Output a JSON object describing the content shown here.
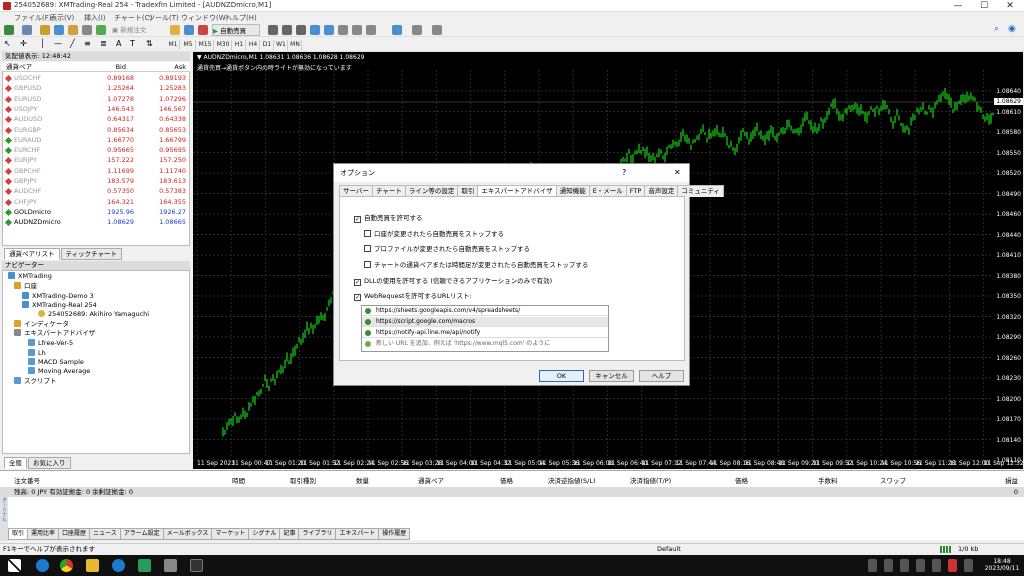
{
  "window": {
    "title": "254052689: XMTrading-Real 254 - Tradexfin Limited - [AUDNZDmicro,M1]",
    "min": "—",
    "max": "☐",
    "close": "✕"
  },
  "menu": [
    "ファイル(F)",
    "表示(V)",
    "挿入(I)",
    "チャート(C)",
    "ツール(T)",
    "ウィンドウ(W)",
    "ヘルプ(H)"
  ],
  "toolbar": {
    "new_order": "新規注文",
    "autotrade": "自動売買"
  },
  "timeframes": [
    "M1",
    "M5",
    "M15",
    "M30",
    "H1",
    "H4",
    "D1",
    "W1",
    "MN"
  ],
  "market_watch": {
    "title": "気配値表示: 12:48:42",
    "col_symbol": "通貨ペア",
    "col_bid": "Bid",
    "col_ask": "Ask",
    "rows": [
      {
        "symbol": "USDCHF",
        "bid": "0.89168",
        "ask": "0.89193",
        "color": "#d43f3f",
        "active": false
      },
      {
        "symbol": "GBPUSD",
        "bid": "1.25264",
        "ask": "1.25283",
        "color": "#d43f3f",
        "active": false
      },
      {
        "symbol": "EURUSD",
        "bid": "1.07278",
        "ask": "1.07296",
        "color": "#d43f3f",
        "active": false
      },
      {
        "symbol": "USDJPY",
        "bid": "146.543",
        "ask": "146.567",
        "color": "#d43f3f",
        "active": false
      },
      {
        "symbol": "AUDUSD",
        "bid": "0.64317",
        "ask": "0.64338",
        "color": "#d43f3f",
        "active": false
      },
      {
        "symbol": "EURGBP",
        "bid": "0.85634",
        "ask": "0.85653",
        "color": "#d43f3f",
        "active": false
      },
      {
        "symbol": "EURAUD",
        "bid": "1.66770",
        "ask": "1.66799",
        "color": "#2a9a2a",
        "active": false
      },
      {
        "symbol": "EURCHF",
        "bid": "0.95665",
        "ask": "0.95695",
        "color": "#2a9a2a",
        "active": false
      },
      {
        "symbol": "EURJPY",
        "bid": "157.222",
        "ask": "157.250",
        "color": "#d43f3f",
        "active": false
      },
      {
        "symbol": "GBPCHF",
        "bid": "1.11699",
        "ask": "1.11740",
        "color": "#d43f3f",
        "active": false
      },
      {
        "symbol": "GBPJPY",
        "bid": "183.579",
        "ask": "183.613",
        "color": "#d43f3f",
        "active": false
      },
      {
        "symbol": "AUDCHF",
        "bid": "0.57350",
        "ask": "0.57383",
        "color": "#d43f3f",
        "active": false
      },
      {
        "symbol": "CHFJPY",
        "bid": "164.321",
        "ask": "164.355",
        "color": "#d43f3f",
        "active": false
      },
      {
        "symbol": "GOLDmicro",
        "bid": "1925.96",
        "ask": "1926.27",
        "color": "#2a9a2a",
        "active": true
      },
      {
        "symbol": "AUDNZDmicro",
        "bid": "1.08629",
        "ask": "1.08665",
        "color": "#2a9a2a",
        "active": true
      }
    ],
    "tabs": [
      "通貨ペアリスト",
      "ティックチャート"
    ]
  },
  "navigator": {
    "title": "ナビゲーター",
    "items": [
      "XMTrading",
      "口座",
      "XMTrading-Demo 3",
      "XMTrading-Real 254",
      "254052689: Akihiro Yamaguchi",
      "インディケータ",
      "エキスパートアドバイザ",
      "Lfree-Ver-5",
      "Lh",
      "MACD Sample",
      "Moving Average",
      "スクリプト"
    ],
    "tabs": [
      "全般",
      "お気に入り"
    ]
  },
  "chart": {
    "info": "▼ AUDNZDmicro,M1  1.08631 1.08636 1.08628 1.08629",
    "info2": "通貨売買→通貨ボタン内の時ライトが無効になっています",
    "price_tag": "1.08629",
    "y_labels": [
      "1.08640",
      "1.08610",
      "1.08580",
      "1.08550",
      "1.08520",
      "1.08490",
      "1.08460",
      "1.08440",
      "1.08410",
      "1.08380",
      "1.08350",
      "1.08320",
      "1.08290",
      "1.08260",
      "1.08230",
      "1.08200",
      "1.08170",
      "1.08140",
      "1.08110"
    ],
    "x_labels": [
      "11 Sep 2023",
      "11 Sep 00:47",
      "11 Sep 01:20",
      "11 Sep 01:52",
      "11 Sep 02:24",
      "11 Sep 02:56",
      "11 Sep 03:28",
      "11 Sep 04:00",
      "11 Sep 04:32",
      "11 Sep 05:04",
      "11 Sep 05:36",
      "11 Sep 06:08",
      "11 Sep 06:40",
      "11 Sep 07:12",
      "11 Sep 07:44",
      "11 Sep 08:16",
      "11 Sep 08:48",
      "11 Sep 09:20",
      "11 Sep 09:52",
      "11 Sep 10:24",
      "11 Sep 10:56",
      "11 Sep 11:28",
      "11 Sep 12:00",
      "11 Sep 12:32"
    ]
  },
  "dialog": {
    "title": "オプション",
    "help": "?",
    "close": "✕",
    "tabs": [
      "サーバー",
      "チャート",
      "ライン等の設定",
      "取引",
      "エキスパートアドバイザ",
      "通知機能",
      "E・メール",
      "FTP",
      "音声設定",
      "コミュニティ"
    ],
    "checks": [
      {
        "label": "自動売買を許可する",
        "checked": true
      },
      {
        "label": "口座が変更されたら自動売買をストップする",
        "checked": false
      },
      {
        "label": "プロファイルが変更されたら自動売買をストップする",
        "checked": false
      },
      {
        "label": "チャートの通貨ペアまたは時間足が変更されたら自動売買をストップする",
        "checked": false
      },
      {
        "label": "DLLの使用を許可する (信頼できるアプリケーションのみで有効)",
        "checked": true
      },
      {
        "label": "WebRequestを許可するURLリスト:",
        "checked": true
      }
    ],
    "urls": [
      "https://sheets.googleapis.com/v4/spreadsheets/",
      "https://script.google.com/macros",
      "https://notify-api.line.me/api/notify"
    ],
    "add_url": "新しい URL を追加、例えば 'https://www.mql5.com' のように",
    "ok": "OK",
    "cancel": "キャンセル",
    "help_btn": "ヘルプ"
  },
  "terminal": {
    "cols": [
      "注文番号",
      "時間",
      "取引種別",
      "数量",
      "通貨ペア",
      "価格",
      "決済逆指値(S/L)",
      "決済指値(T/P)",
      "価格",
      "手数料",
      "スワップ",
      "損益"
    ],
    "balance": "残高: 0 JPY  有効証拠金: 0  余剰証拠金: 0",
    "balance_value": "0",
    "tabs": [
      "取引",
      "運用比率",
      "口座履歴",
      "ニュース",
      "アラーム設定",
      "メールボックス",
      "マーケット",
      "シグナル",
      "記事",
      "ライブラリ",
      "エキスパート",
      "操作履歴"
    ],
    "side_label": "ターミナル"
  },
  "statusbar": {
    "help": "F1キーでヘルプが表示されます",
    "profile": "Default",
    "traffic": "1/0 kb"
  },
  "taskbar": {
    "time": "18:48",
    "date": "2023/09/11"
  }
}
